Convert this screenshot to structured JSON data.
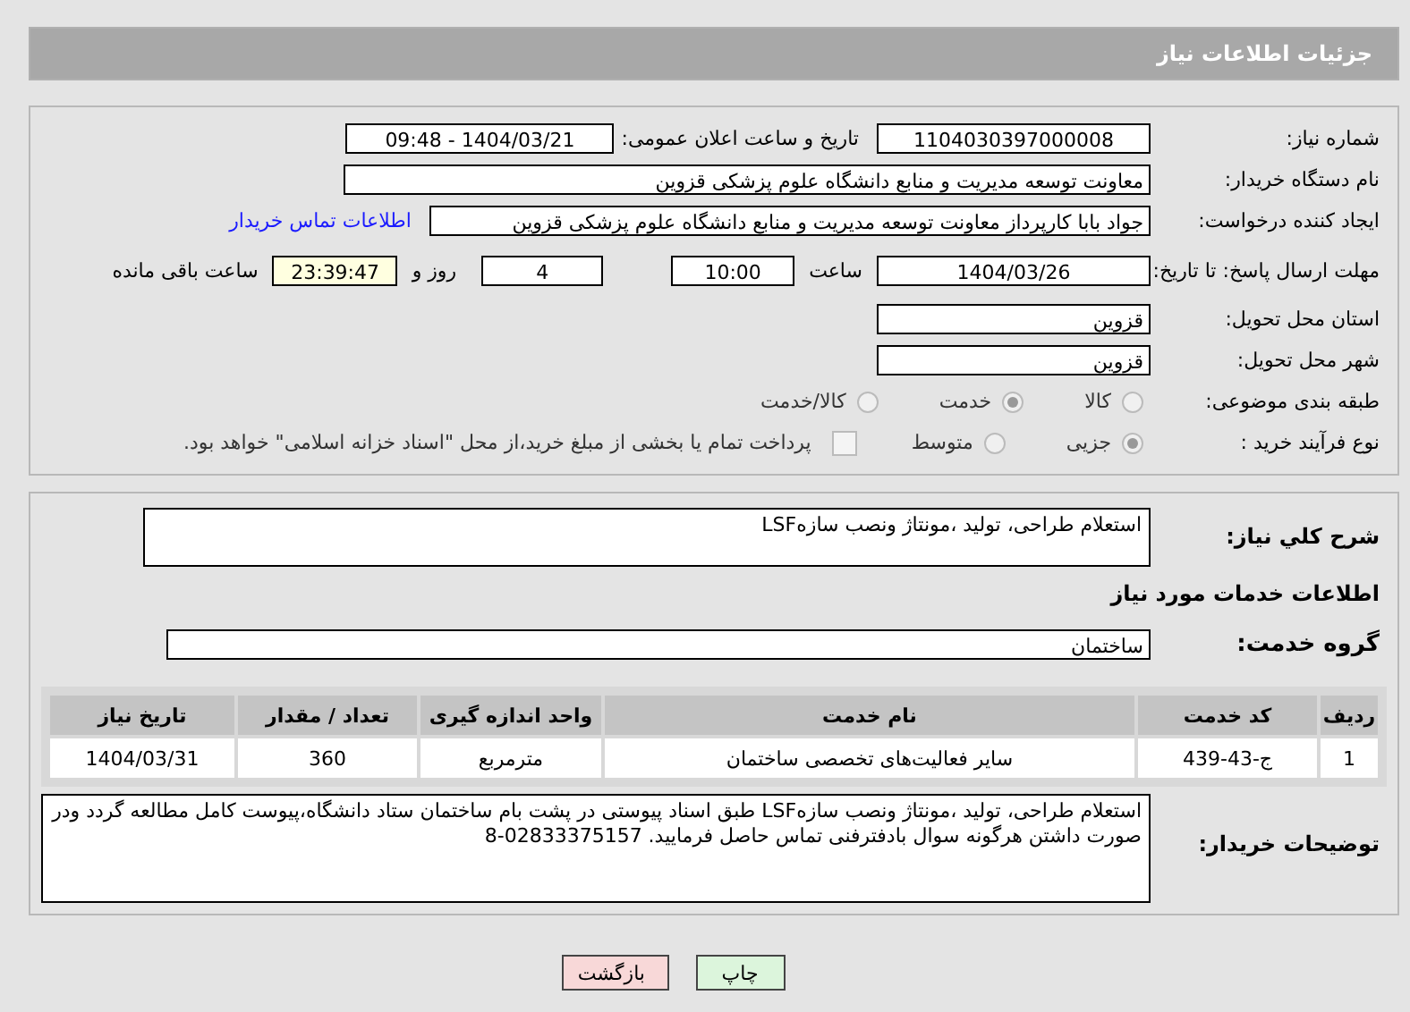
{
  "header": {
    "title": "جزئیات اطلاعات نیاز"
  },
  "need_number": {
    "label": "شماره نیاز:",
    "value": "1104030397000008"
  },
  "announce": {
    "label": "تاریخ و ساعت اعلان عمومی:",
    "value": "1404/03/21 - 09:48"
  },
  "buyer_org": {
    "label": "نام دستگاه خریدار:",
    "value": "معاونت توسعه مدیریت و منابع دانشگاه علوم پزشکی قزوین"
  },
  "requester": {
    "label": "ایجاد کننده درخواست:",
    "value": "جواد بابا کارپرداز معاونت توسعه مدیریت و منابع دانشگاه علوم پزشکی قزوین",
    "link": "اطلاعات تماس خریدار"
  },
  "deadline": {
    "label": "مهلت ارسال پاسخ: تا تاریخ:",
    "date": "1404/03/26",
    "time_label": "ساعت",
    "time": "10:00",
    "days": "4",
    "days_label": "روز و",
    "remaining": "23:39:47",
    "remaining_label": "ساعت باقی مانده"
  },
  "province": {
    "label": "استان محل تحویل:",
    "value": "قزوین"
  },
  "city": {
    "label": "شهر محل تحویل:",
    "value": "قزوین"
  },
  "category": {
    "label": "طبقه بندی موضوعی:",
    "options": [
      {
        "label": "کالا",
        "selected": false
      },
      {
        "label": "خدمت",
        "selected": true
      },
      {
        "label": "کالا/خدمت",
        "selected": false
      }
    ]
  },
  "purchase_type": {
    "label": "نوع فرآیند خرید :",
    "options": [
      {
        "label": "جزیی",
        "selected": true
      },
      {
        "label": "متوسط",
        "selected": false
      }
    ],
    "payment": {
      "checked": false,
      "text": "پرداخت تمام یا بخشی از مبلغ خرید،از محل \"اسناد خزانه اسلامی\" خواهد بود."
    }
  },
  "description": {
    "label": "شرح کلي نياز:",
    "value": "استعلام طراحی، تولید ،مونتاژ ونصب سازهLSF"
  },
  "services_heading": "اطلاعات خدمات مورد نیاز",
  "service_group": {
    "label": "گروه خدمت:",
    "value": "ساختمان"
  },
  "table": {
    "columns": [
      "ردیف",
      "کد خدمت",
      "نام خدمت",
      "واحد اندازه گیری",
      "تعداد / مقدار",
      "تاریخ نیاز"
    ],
    "rows": [
      [
        "1",
        "ج-43-439",
        "سایر فعالیت‌های تخصصی ساختمان",
        "مترمربع",
        "360",
        "1404/03/31"
      ]
    ]
  },
  "buyer_notes": {
    "label": "توضیحات خریدار:",
    "value": "استعلام طراحی، تولید ،مونتاژ ونصب سازهLSF طبق اسناد پیوستی در پشت بام ساختمان ستاد دانشگاه،پیوست کامل مطالعه گردد ودر صورت داشتن هرگونه سوال بادفترفنی تماس حاصل فرمایید. 02833375157-8"
  },
  "buttons": [
    {
      "label": "چاپ",
      "kind": "print"
    },
    {
      "label": "بازگشت",
      "kind": "back"
    }
  ]
}
